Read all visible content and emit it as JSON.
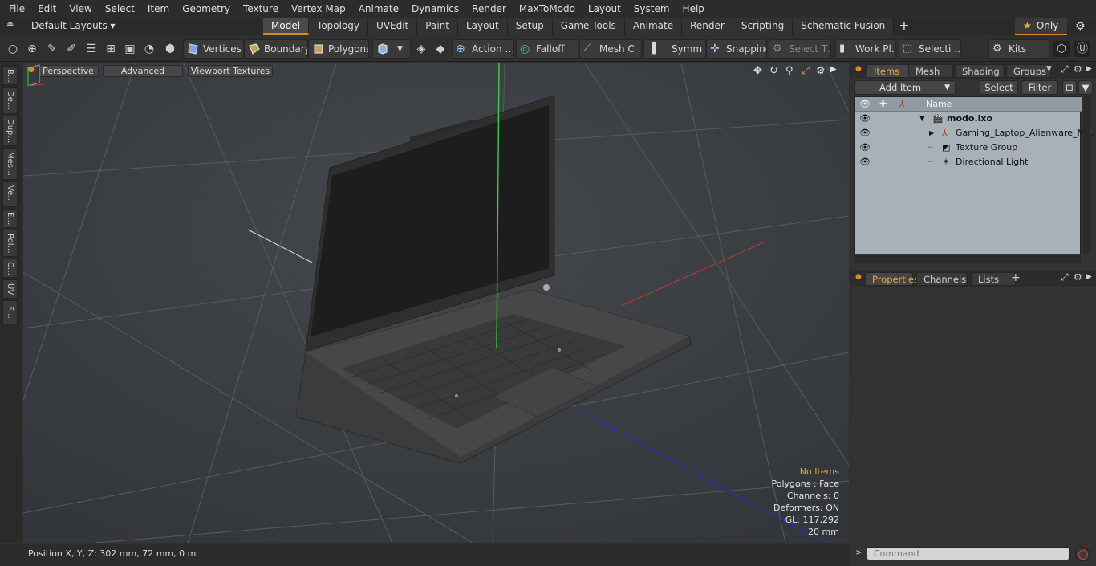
{
  "menu": [
    "File",
    "Edit",
    "View",
    "Select",
    "Item",
    "Geometry",
    "Texture",
    "Vertex Map",
    "Animate",
    "Dynamics",
    "Render",
    "MaxToModo",
    "Layout",
    "System",
    "Help"
  ],
  "layout_selector": "Default Layouts ▾",
  "tabs": [
    "Model",
    "Topology",
    "UVEdit",
    "Paint",
    "Layout",
    "Setup",
    "Game Tools",
    "Animate",
    "Render",
    "Scripting",
    "Schematic Fusion"
  ],
  "only_label": "Only",
  "toolbar": {
    "vertices": "Vertices",
    "boundary": "Boundary",
    "polygons": "Polygons",
    "action": "Action …",
    "falloff": "Falloff",
    "mesh": "Mesh C …",
    "symm": "Symm …",
    "snapping": "Snapping",
    "select_t": "Select T…",
    "work_pl": "Work Pl…",
    "selecti": "Selecti …",
    "kits": "Kits"
  },
  "left_tabs": [
    "B…",
    "De…",
    "Dup…",
    "Mes…",
    "Ve…",
    "E…",
    "Pol…",
    "C…",
    "UV",
    "F…"
  ],
  "viewport": {
    "perspective": "Perspective",
    "advanced": "Advanced",
    "viewport_textures": "Viewport Textures",
    "info": {
      "no_items": "No Items",
      "polygons": "Polygons : Face",
      "channels": "Channels: 0",
      "deformers": "Deformers: ON",
      "gl": "GL: 117,292",
      "scale": "20 mm"
    }
  },
  "status": {
    "position": "Position X, Y, Z:   302 mm, 72 mm, 0 m"
  },
  "items_panel": {
    "tabs": [
      "Items",
      "Mesh …",
      "Shading",
      "Groups"
    ],
    "add_item": "Add Item",
    "select": "Select",
    "filter": "Filter",
    "name_header": "Name",
    "tree": [
      {
        "label": "modo.lxo"
      },
      {
        "label": "Gaming_Laptop_Alienware_M…"
      },
      {
        "label": "Texture Group"
      },
      {
        "label": "Directional Light"
      }
    ]
  },
  "properties_panel": {
    "tabs": [
      "Properties",
      "Channels",
      "Lists"
    ]
  },
  "command": {
    "placeholder": "Command"
  },
  "colors": {
    "accent": "#d58a29",
    "x_axis": "#c0392b",
    "y_axis": "#3ecf3e",
    "z_axis": "#2a2ad8"
  }
}
